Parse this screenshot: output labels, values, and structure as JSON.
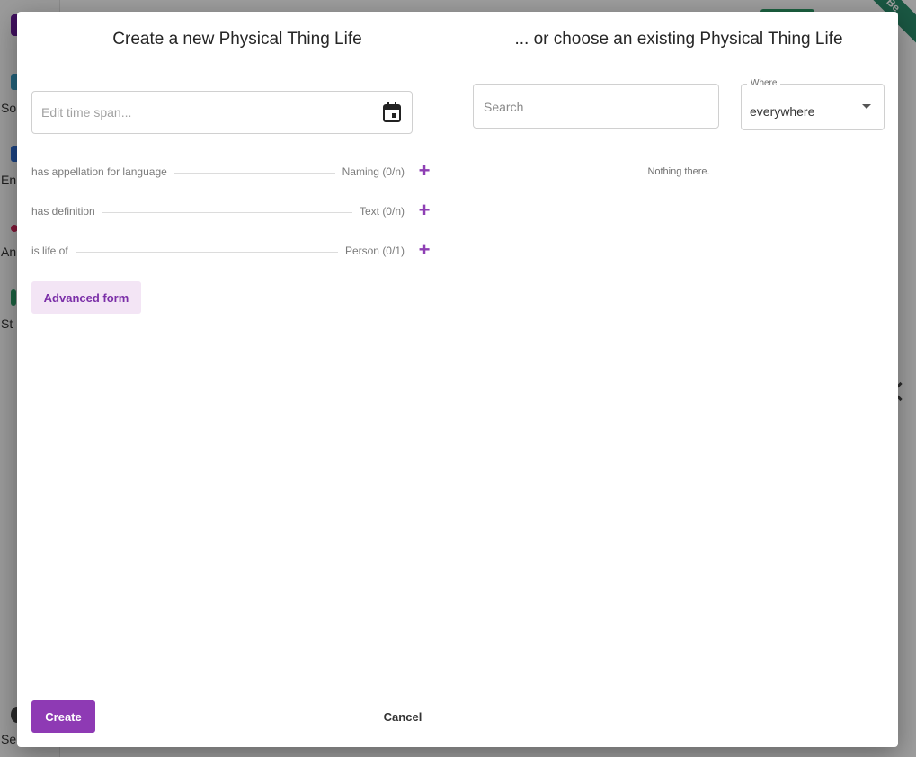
{
  "background": {
    "ribbon_text": "Be",
    "sidebar_labels": [
      "So",
      "En",
      "An",
      "St",
      "Se"
    ]
  },
  "dialog": {
    "create": {
      "title": "Create a new Physical Thing Life",
      "timespan_placeholder": "Edit time span...",
      "properties": [
        {
          "label": "has appellation for language",
          "range": "Naming",
          "cardinality": "(0/n)",
          "add_icon": "+"
        },
        {
          "label": "has definition",
          "range": "Text",
          "cardinality": "(0/n)",
          "add_icon": "+"
        },
        {
          "label": "is life of",
          "range": "Person",
          "cardinality": "(0/1)",
          "add_icon": "+"
        }
      ],
      "advanced_form_label": "Advanced form",
      "create_label": "Create",
      "cancel_label": "Cancel"
    },
    "choose": {
      "title": "... or choose an existing Physical Thing Life",
      "search_placeholder": "Search",
      "where_label": "Where",
      "where_value": "everywhere",
      "empty_text": "Nothing there."
    }
  },
  "colors": {
    "accent": "#8e3ab4",
    "accent_light": "#f3e5f5"
  }
}
